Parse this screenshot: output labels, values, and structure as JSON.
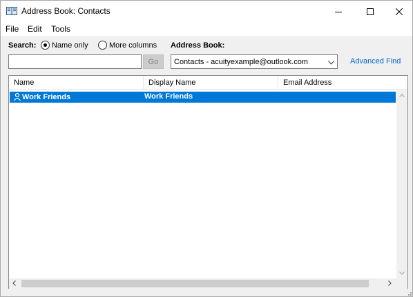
{
  "window": {
    "title": "Address Book: Contacts"
  },
  "menu": {
    "items": [
      {
        "label": "File"
      },
      {
        "label": "Edit"
      },
      {
        "label": "Tools"
      }
    ]
  },
  "search": {
    "label": "Search:",
    "options": [
      {
        "label": "Name only",
        "checked": true
      },
      {
        "label": "More columns",
        "checked": false
      }
    ],
    "value": "",
    "go_label": "Go"
  },
  "address_book": {
    "label": "Address Book:",
    "selected": "Contacts - acuityexample@outlook.com",
    "advanced_find": "Advanced Find"
  },
  "list": {
    "columns": [
      "Name",
      "Display Name",
      "Email Address"
    ],
    "rows": [
      {
        "name": "Work Friends",
        "display_name": "Work Friends",
        "email": "",
        "selected": true
      }
    ]
  },
  "colors": {
    "selection": "#0078d7",
    "link": "#0066cc"
  }
}
